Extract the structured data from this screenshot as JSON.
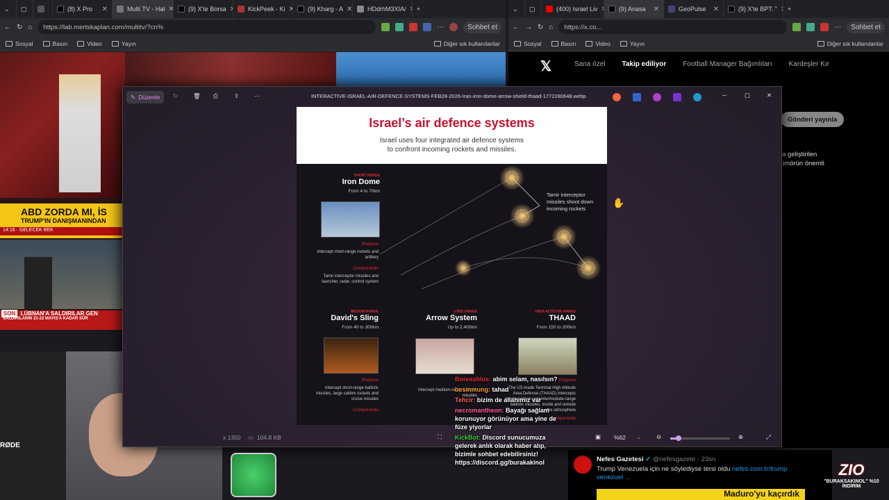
{
  "left_browser": {
    "tabs": [
      {
        "label": "(8) X Pro"
      },
      {
        "label": "Multi TV - Hal"
      },
      {
        "label": "(9) X'te Borsa"
      },
      {
        "label": "KickPeek - Ki"
      },
      {
        "label": "(9) Kharg - A"
      },
      {
        "label": "HDdrhM3XIA/"
      }
    ],
    "url": "https://lab.mertskaplan.com/multitv/?cn%",
    "chat_label": "Sohbet et",
    "bookmarks": [
      "Sosyal",
      "Basın",
      "Video",
      "Yayın"
    ],
    "other_bookmarks": "Diğer sık kullanılanlar"
  },
  "right_browser": {
    "tabs": [
      {
        "label": "(400) Israel Liv"
      },
      {
        "label": "(9) Anasa"
      },
      {
        "label": "GeoPulse"
      },
      {
        "label": "(9) X'te BPT: \""
      }
    ],
    "url": "https://x.co...",
    "chat_label": "Sohbet et",
    "bookmarks": [
      "Sosyal",
      "Basın",
      "Video",
      "Yayın"
    ],
    "other_bookmarks": "Diğer sık kullanılanlar"
  },
  "x_feed": {
    "tabs": [
      "Sana özel",
      "Takip ediliyor",
      "Football Manager Bağımlıları",
      "Kardeşler Kır"
    ],
    "post_button": "Gönderi yayınla",
    "snippet1": "la geliştirilen",
    "snippet2": "ümörün önemli",
    "tweet": {
      "author": "Nefes Gazetesi",
      "handle": "@nefesgazete · 23sn",
      "text": "Trump Venezuela için ne söylediyse tersi oldu",
      "link": "nefes.com.tr/trump venezuel ...",
      "banner": "Maduro'yu kaçırdık"
    }
  },
  "tv": {
    "headline1": "ABD ZORDA MI, İS",
    "headline2": "TRUMP'IN DANIŞMANINDAN",
    "ticker_time": "14:16",
    "ticker": "GELECEK BEK",
    "headline3": "LÜBNAN'A SALDIRILAR GEN",
    "ticker2": "SALDIRILARIN 21-22 MAYIS'A KADAR SÜR",
    "son": "SON",
    "durum": "dakika"
  },
  "viewer": {
    "edit": "Düzenle",
    "filename": "INTERACTIVE-ISRAEL-AIR-DEFENCE-SYSTEMS-FEB28-2026-Iran-iron-dome-arrow-shield-thaad-1772280648.webp",
    "dims": "x 1350",
    "size": "104.8 KB",
    "zoom": "%62"
  },
  "infographic": {
    "title": "Israel’s air defence systems",
    "subtitle1": "Israel uses four integrated air defence systems",
    "subtitle2": "to confront incoming rockets and missiles.",
    "intercept_note": "Tamir interceptor missiles shoot down incoming rockets",
    "iron_dome": {
      "range_label": "SHORT RANGE",
      "name": "Iron Dome",
      "range": "From 4 to 70km",
      "purpose_label": "Purpose",
      "purpose": "Intercept short-range rockets and artillery",
      "components_label": "Components",
      "components": "Tamir interceptor missiles and launcher, radar, control system"
    },
    "davids_sling": {
      "range_label": "MEDIUM RANGE",
      "name": "David's Sling",
      "range": "From 40 to 300km",
      "purpose_label": "Purpose",
      "purpose": "Intercept short-range ballistic missiles, large calibre rockets and cruise missiles",
      "components_label": "Components"
    },
    "arrow": {
      "range_label": "LONG RANGE",
      "name": "Arrow System",
      "range": "Up to 2,400km",
      "purpose": "Intercept medium-range ballistic missiles"
    },
    "thaad": {
      "range_label": "HIGH-ALTITUDE RANGE",
      "name": "THAAD",
      "range": "From 150 to 200km",
      "purpose_label": "Purpose",
      "purpose": "The US-made Terminal High Altitude Area Defense (THAAD) intercepts short, medium and intermediate-range ballistic missiles, inside and outside the atmosphere",
      "components_label": "Components"
    }
  },
  "chat": [
    {
      "user": "Boreasblus:",
      "msg": "abim selam, nasılsın?"
    },
    {
      "user": "besinmung:",
      "msg": "tahad"
    },
    {
      "user": "Tehcir:",
      "msg": "bizim de allahımız var"
    },
    {
      "user": "necromantheon:",
      "msg": "Bayağı sağlam korunuyor görünüyor ama yine de füze yiyorlar"
    },
    {
      "user": "KickBot:",
      "msg": "Discord sunucumuza gelerek anlık olarak haber alıp, bizimle sohbet edebilirsiniz! https://discord.gg/burakakinol"
    }
  ],
  "overlay": {
    "brand": "ZIO",
    "promo": "\"BURAKSAKINOL\" %10 İNDİRİM",
    "rode": "RØDE"
  }
}
